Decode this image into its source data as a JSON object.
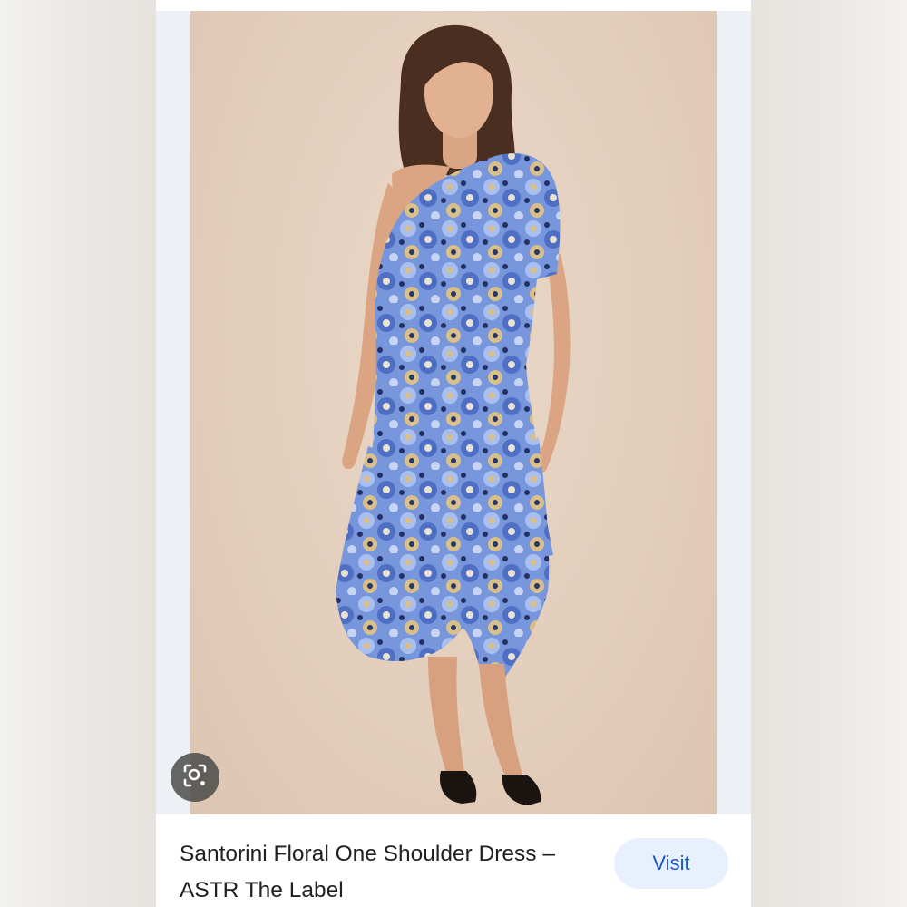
{
  "result": {
    "title": "Santorini Floral One Shoulder Dress – ASTR The Label",
    "visit_label": "Visit",
    "image_subject": "Model wearing blue floral one-shoulder midi dress",
    "icons": {
      "lens": "lens-search-icon"
    },
    "colors": {
      "background": "#e3cdbb",
      "dress_primary": "#6f8fd8",
      "dress_accent": "#d9c08a",
      "visit_bg": "#e8f0fe",
      "visit_text": "#1a56c4"
    }
  }
}
